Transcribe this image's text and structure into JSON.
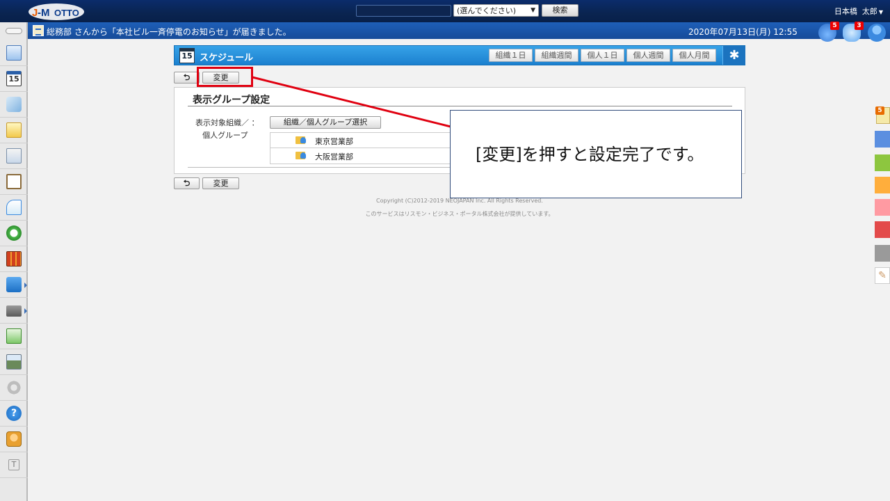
{
  "header": {
    "logo_text": "J-MOTTO",
    "search_value": "",
    "select_value": "(選んでください)",
    "search_button": "検索",
    "user_location": "日本橋",
    "user_name": "太郎"
  },
  "notice": {
    "message": "総務部 さんから「本社ビル一斉停電のお知らせ」が届きました。",
    "datetime": "2020年07月13日(月) 12:55",
    "antenna_badge": "5",
    "chat_badge": "3"
  },
  "schedule": {
    "title": "スケジュール",
    "calendar_day": "15",
    "views": [
      "組織１日",
      "組織週間",
      "個人１日",
      "個人週間",
      "個人月間"
    ],
    "gear_label": "✱"
  },
  "actions": {
    "back_label": "⮌",
    "change_label": "変更"
  },
  "panel": {
    "title": "表示グループ設定",
    "field_label_line1": "表示対象組織／ ：",
    "field_label_line2": "個人グループ",
    "select_group_button": "組織／個人グループ選択",
    "groups": [
      "東京営業部",
      "大阪営業部"
    ]
  },
  "callout": {
    "text": "[変更]を押すと設定完了です。",
    "line_color": "#e00010"
  },
  "sidebar": {
    "left_icons": [
      "home-icon",
      "calendar-icon",
      "facility-icon",
      "memo-icon",
      "bulletin-icon",
      "report-icon",
      "search-doc-icon",
      "sync-icon",
      "cabinet-icon",
      "neo-icon",
      "folder-icon",
      "app-icon-1",
      "app-icon-2",
      "settings-icon",
      "help-icon",
      "support-icon",
      "text-icon"
    ],
    "calendar_day": "15",
    "memo_badge": "5",
    "right_tab_colors": [
      "#5b8fe0",
      "#8dc63f",
      "#ffae3c",
      "#ff9aa2",
      "#e34a4a",
      "#9a9a9a"
    ]
  },
  "footer": {
    "copyright": "Copyright (C)2012-2019 NEOJAPAN Inc. All Rights Reserved.",
    "provider": "このサービスはリスモン・ビジネス・ポータル株式会社が提供しています。"
  }
}
